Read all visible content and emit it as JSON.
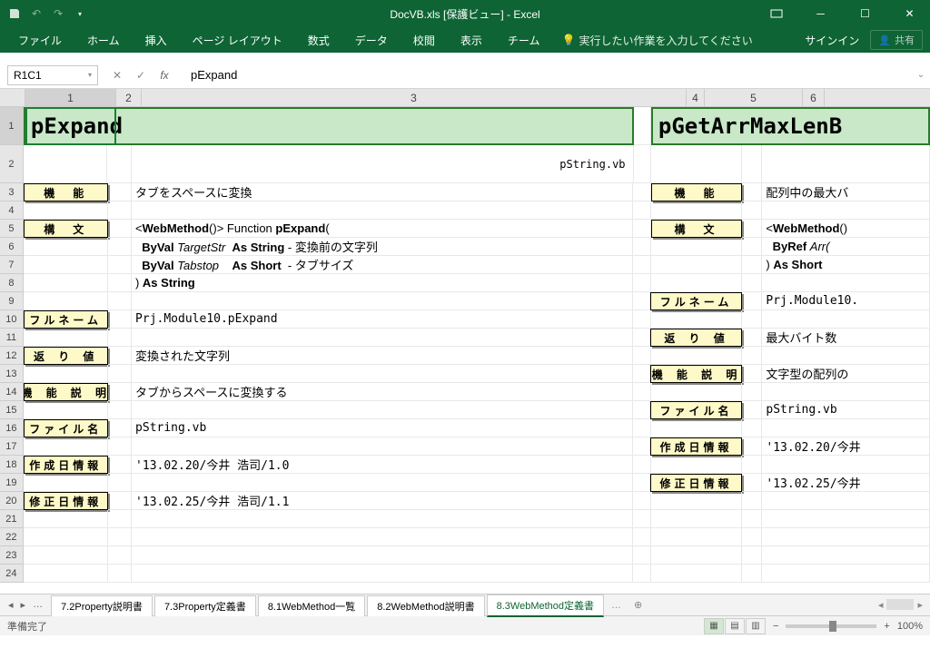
{
  "title": "DocVB.xls  [保護ビュー] - Excel",
  "qat": {
    "save": "save",
    "undo": "undo",
    "redo": "redo"
  },
  "ribbon": {
    "tabs": [
      "ファイル",
      "ホーム",
      "挿入",
      "ページ レイアウト",
      "数式",
      "データ",
      "校閲",
      "表示",
      "チーム"
    ],
    "tell_me": "実行したい作業を入力してください",
    "signin": "サインイン",
    "share": "共有"
  },
  "namebox": "R1C1",
  "formula": "pExpand",
  "cols": [
    "1",
    "2",
    "3",
    "4",
    "5",
    "6"
  ],
  "rows_h": [
    "1",
    "2",
    "3",
    "4",
    "5",
    "6",
    "7",
    "8",
    "9",
    "10",
    "11",
    "12",
    "13",
    "14",
    "15",
    "16",
    "17",
    "18",
    "19",
    "20",
    "21",
    "22",
    "23",
    "24"
  ],
  "left": {
    "title": "pExpand",
    "subtitle": "pString.vb",
    "labels": {
      "kinou": "機　能",
      "koubun": "構　文",
      "fullname": "フルネーム",
      "kaeri": "返 り 値",
      "setsumei": "機 能 説 明",
      "file": "ファイル名",
      "sakusei": "作成日情報",
      "shusei": "修正日情報"
    },
    "vals": {
      "kinou": "タブをスペースに変換",
      "koubun1": "<WebMethod()> Function pExpand(",
      "koubun2": "  ByVal TargetStr  As String - 変換前の文字列",
      "koubun3": "  ByVal Tabstop    As Short  - タブサイズ",
      "koubun4": ") As String",
      "fullname": "Prj.Module10.pExpand",
      "kaeri": "変換された文字列",
      "setsumei": "タブからスペースに変換する",
      "file": "pString.vb",
      "sakusei": "'13.02.20/今井 浩司/1.0",
      "shusei": "'13.02.25/今井 浩司/1.1"
    }
  },
  "right": {
    "title": "pGetArrMaxLenB",
    "labels": {
      "kinou": "機　能",
      "koubun": "構　文",
      "fullname": "フルネーム",
      "kaeri": "返 り 値",
      "setsumei": "機 能 説 明",
      "file": "ファイル名",
      "sakusei": "作成日情報",
      "shusei": "修正日情報"
    },
    "vals": {
      "kinou": "配列中の最大バ",
      "koubun1": "<WebMethod()>",
      "koubun2": "  ByRef Arr(",
      "koubun3": ") As Short",
      "fullname": "Prj.Module10.",
      "kaeri": "最大バイト数",
      "setsumei": "文字型の配列の",
      "file": "pString.vb",
      "sakusei": "'13.02.20/今井",
      "shusei": "'13.02.25/今井"
    }
  },
  "sheets": [
    "7.2Property説明書",
    "7.3Property定義書",
    "8.1WebMethod一覧",
    "8.2WebMethod説明書",
    "8.3WebMethod定義書"
  ],
  "active_sheet": 4,
  "status": "準備完了",
  "zoom": "100%"
}
